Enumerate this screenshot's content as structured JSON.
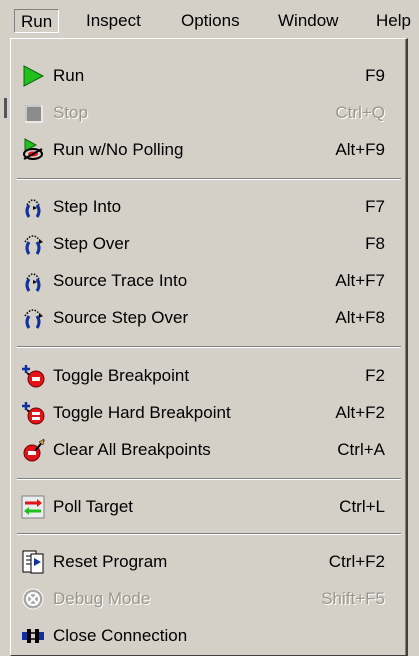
{
  "menubar": {
    "items": [
      "Run",
      "Inspect",
      "Options",
      "Window",
      "Help"
    ]
  },
  "menu": {
    "items": [
      {
        "label": "Run",
        "shortcut": "F9",
        "icon": "run-triangle-icon",
        "enabled": true
      },
      {
        "label": "Stop",
        "shortcut": "Ctrl+Q",
        "icon": "stop-square-icon",
        "enabled": false
      },
      {
        "label": "Run w/No Polling",
        "shortcut": "Alt+F9",
        "icon": "run-no-polling-icon",
        "enabled": true
      },
      {
        "label": "Step Into",
        "shortcut": "F7",
        "icon": "step-into-icon",
        "enabled": true
      },
      {
        "label": "Step Over",
        "shortcut": "F8",
        "icon": "step-over-icon",
        "enabled": true
      },
      {
        "label": "Source Trace Into",
        "shortcut": "Alt+F7",
        "icon": "source-trace-into-icon",
        "enabled": true
      },
      {
        "label": "Source Step Over",
        "shortcut": "Alt+F8",
        "icon": "source-step-over-icon",
        "enabled": true
      },
      {
        "label": "Toggle Breakpoint",
        "shortcut": "F2",
        "icon": "breakpoint-icon",
        "enabled": true
      },
      {
        "label": "Toggle Hard Breakpoint",
        "shortcut": "Alt+F2",
        "icon": "hard-breakpoint-icon",
        "enabled": true
      },
      {
        "label": "Clear All Breakpoints",
        "shortcut": "Ctrl+A",
        "icon": "clear-breakpoints-icon",
        "enabled": true
      },
      {
        "label": "Poll Target",
        "shortcut": "Ctrl+L",
        "icon": "poll-target-icon",
        "enabled": true
      },
      {
        "label": "Reset Program",
        "shortcut": "Ctrl+F2",
        "icon": "reset-program-icon",
        "enabled": true
      },
      {
        "label": "Debug Mode",
        "shortcut": "Shift+F5",
        "icon": "debug-mode-icon",
        "enabled": false
      },
      {
        "label": "Close Connection",
        "shortcut": "",
        "icon": "close-connection-icon",
        "enabled": true
      }
    ]
  },
  "colors": {
    "face": "#d4d0c8",
    "disabled_text": "#9a968c",
    "run_green": "#22c01c",
    "step_blue": "#1030a0",
    "breakpoint_red": "#e0151a"
  }
}
